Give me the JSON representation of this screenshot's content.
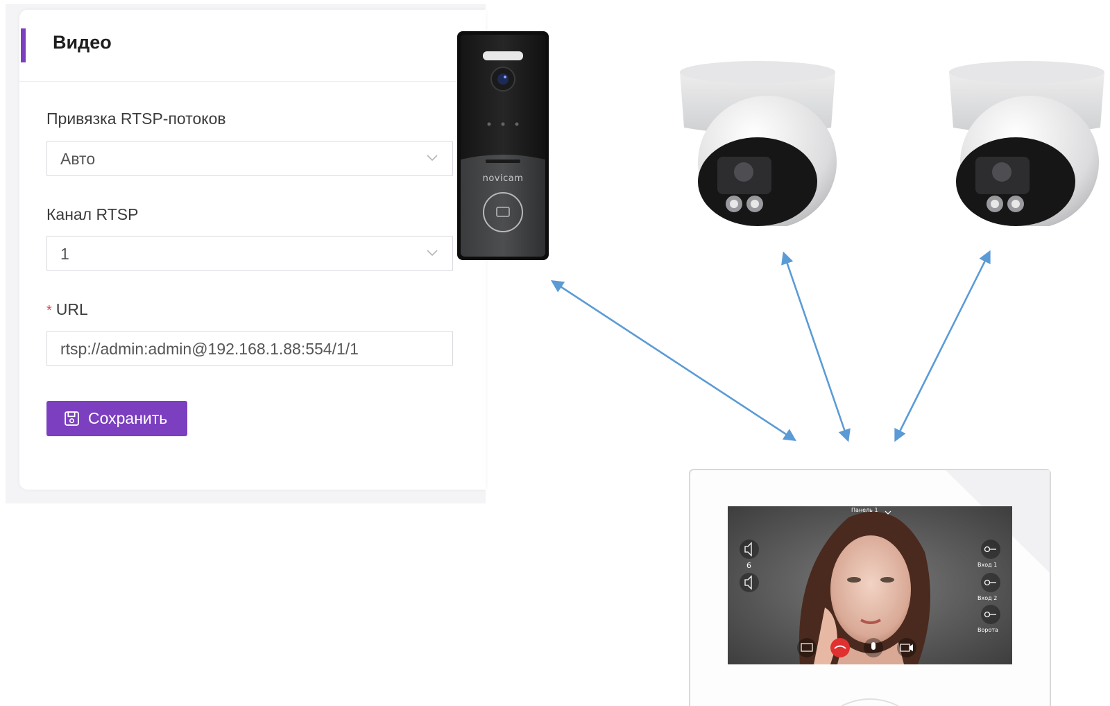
{
  "panel": {
    "title": "Видео",
    "rtsp_binding": {
      "label": "Привязка RTSP-потоков",
      "value": "Авто"
    },
    "rtsp_channel": {
      "label": "Канал RTSP",
      "value": "1"
    },
    "url": {
      "label": "URL",
      "required_mark": "*",
      "value": "rtsp://admin:admin@192.168.1.88:554/1/1"
    },
    "save_button": {
      "label": "Сохранить"
    }
  },
  "doorbell": {
    "brand": "novicam"
  },
  "monitor": {
    "panel_selector": "Панель 1",
    "volume_level": "6",
    "buttons": {
      "entry1": "Вход 1",
      "entry2": "Вход 2",
      "gate": "Ворота"
    }
  },
  "colors": {
    "accent": "#7b3fbf",
    "arrow": "#5b9bd5",
    "required": "#e5484d"
  }
}
